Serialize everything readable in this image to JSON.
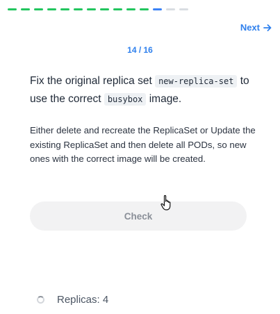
{
  "progress": {
    "total_steps": 16,
    "completed_steps": 13,
    "current_step": 14,
    "visible_segments": [
      "done",
      "done",
      "done",
      "done",
      "done",
      "done",
      "done",
      "done",
      "done",
      "done",
      "done",
      "current",
      "todo",
      "todo"
    ],
    "colors": {
      "done": "#22c55e",
      "current": "#3b82f6",
      "todo": "#d9dde2"
    }
  },
  "nav": {
    "next_label": "Next"
  },
  "counter": {
    "text": "14 / 16"
  },
  "question": {
    "part1": "Fix the original replica set ",
    "code1": "new-replica-set",
    "part2": " to use the correct ",
    "code2": "busybox",
    "part3": " image."
  },
  "description": {
    "text": "Either delete and recreate the ReplicaSet or Update the existing ReplicaSet and then delete all PODs, so new ones with the correct image will be created."
  },
  "check_button": {
    "label": "Check"
  },
  "tasks": [
    {
      "label": "Replicas: 4",
      "status": "pending"
    }
  ],
  "accent_color": "#2f80ed"
}
